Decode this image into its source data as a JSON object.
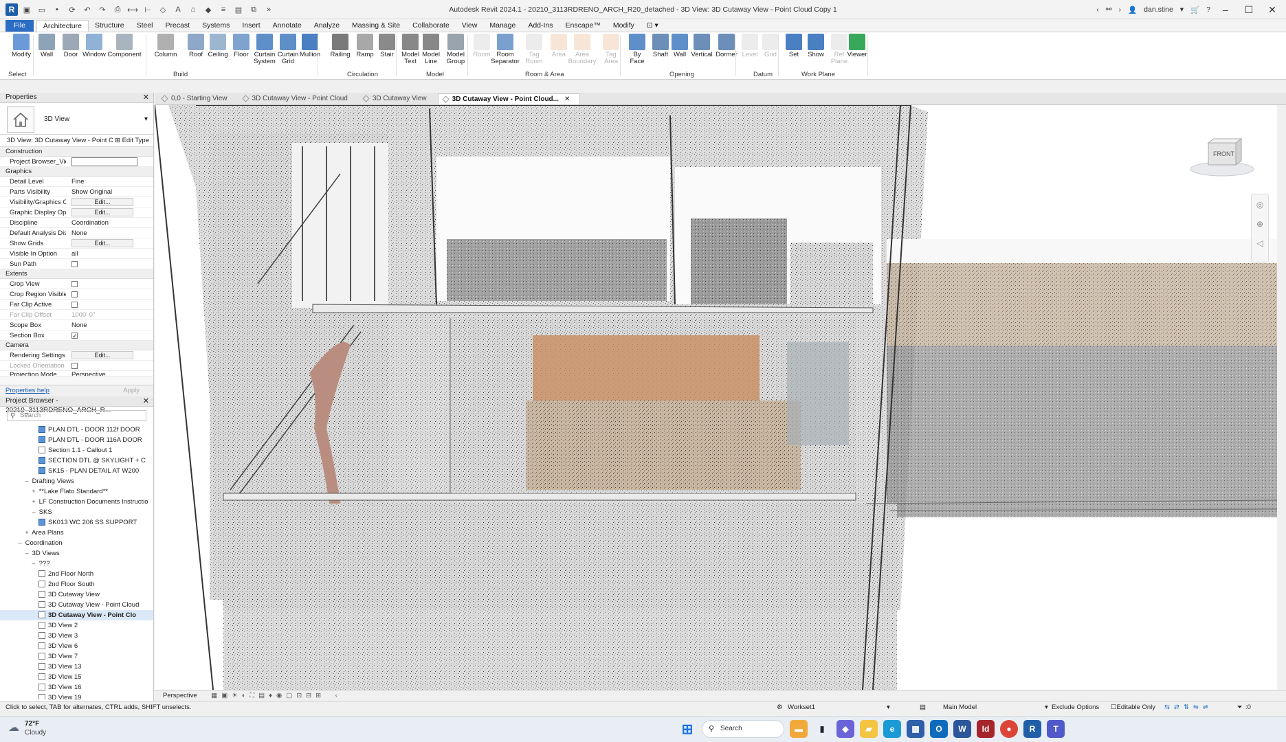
{
  "app": {
    "title": "Autodesk Revit 2024.1 - 20210_3113RDRENO_ARCH_R20_detached - 3D View: 3D Cutaway View - Point Cloud Copy 1",
    "user": "dan.stine"
  },
  "ribbon_tabs": [
    "File",
    "Architecture",
    "Structure",
    "Steel",
    "Precast",
    "Systems",
    "Insert",
    "Annotate",
    "Analyze",
    "Massing & Site",
    "Collaborate",
    "View",
    "Manage",
    "Add-Ins",
    "Enscape™",
    "Modify"
  ],
  "active_ribbon_tab": "Architecture",
  "ribbon": {
    "tools": [
      {
        "label": "Modify",
        "icon": "modify-arrow-icon"
      },
      {
        "label": "Wall",
        "icon": "wall-icon"
      },
      {
        "label": "Door",
        "icon": "door-icon"
      },
      {
        "label": "Window",
        "icon": "window-icon"
      },
      {
        "label": "Component",
        "icon": "component-icon"
      },
      {
        "label": "Column",
        "icon": "column-icon"
      },
      {
        "label": "Roof",
        "icon": "roof-icon"
      },
      {
        "label": "Ceiling",
        "icon": "ceiling-icon"
      },
      {
        "label": "Floor",
        "icon": "floor-icon"
      },
      {
        "label": "Curtain System",
        "icon": "curtain-system-icon"
      },
      {
        "label": "Curtain Grid",
        "icon": "curtain-grid-icon"
      },
      {
        "label": "Mullion",
        "icon": "mullion-icon"
      },
      {
        "label": "Railing",
        "icon": "railing-icon"
      },
      {
        "label": "Ramp",
        "icon": "ramp-icon"
      },
      {
        "label": "Stair",
        "icon": "stair-icon"
      },
      {
        "label": "Model Text",
        "icon": "model-text-icon"
      },
      {
        "label": "Model Line",
        "icon": "model-line-icon"
      },
      {
        "label": "Model Group",
        "icon": "model-group-icon"
      },
      {
        "label": "Room",
        "icon": "room-icon"
      },
      {
        "label": "Room Separator",
        "icon": "room-separator-icon"
      },
      {
        "label": "Tag Room",
        "icon": "tag-room-icon"
      },
      {
        "label": "Area",
        "icon": "area-icon"
      },
      {
        "label": "Area Boundary",
        "icon": "area-boundary-icon"
      },
      {
        "label": "Tag Area",
        "icon": "tag-area-icon"
      },
      {
        "label": "By Face",
        "icon": "by-face-icon"
      },
      {
        "label": "Shaft",
        "icon": "shaft-icon"
      },
      {
        "label": "Wall",
        "icon": "wall-opening-icon"
      },
      {
        "label": "Vertical",
        "icon": "vertical-icon"
      },
      {
        "label": "Dormer",
        "icon": "dormer-icon"
      },
      {
        "label": "Level",
        "icon": "level-icon"
      },
      {
        "label": "Grid",
        "icon": "grid-icon"
      },
      {
        "label": "Set",
        "icon": "set-icon"
      },
      {
        "label": "Show",
        "icon": "show-icon"
      },
      {
        "label": "Ref Plane",
        "icon": "ref-plane-icon"
      },
      {
        "label": "Viewer",
        "icon": "viewer-icon"
      }
    ],
    "groups": [
      "Select",
      "Build",
      "Circulation",
      "Model",
      "Room & Area",
      "Opening",
      "Datum",
      "Work Plane"
    ]
  },
  "properties": {
    "title": "Properties",
    "type_name": "3D View",
    "instance": "3D View: 3D Cutaway View - Point C",
    "edit_type": "Edit Type",
    "categories": {
      "construction": "Construction",
      "graphics": "Graphics",
      "extents": "Extents",
      "camera": "Camera"
    },
    "rows": {
      "project_browser_view": {
        "name": "Project Browser_View...",
        "value": ""
      },
      "detail_level": {
        "name": "Detail Level",
        "value": "Fine"
      },
      "parts_visibility": {
        "name": "Parts Visibility",
        "value": "Show Original"
      },
      "vis_graphics": {
        "name": "Visibility/Graphics O...",
        "value": "Edit..."
      },
      "graphic_display": {
        "name": "Graphic Display Opti...",
        "value": "Edit..."
      },
      "discipline": {
        "name": "Discipline",
        "value": "Coordination"
      },
      "default_analysis": {
        "name": "Default Analysis Dis...",
        "value": "None"
      },
      "show_grids": {
        "name": "Show Grids",
        "value": "Edit..."
      },
      "visible_in_option": {
        "name": "Visible In Option",
        "value": "all"
      },
      "sun_path": {
        "name": "Sun Path",
        "value": ""
      },
      "crop_view": {
        "name": "Crop View",
        "value": ""
      },
      "crop_region_visible": {
        "name": "Crop Region Visible",
        "value": ""
      },
      "far_clip_active": {
        "name": "Far Clip Active",
        "value": ""
      },
      "far_clip_offset": {
        "name": "Far Clip Offset",
        "value": "1000'  0\""
      },
      "scope_box": {
        "name": "Scope Box",
        "value": "None"
      },
      "section_box": {
        "name": "Section Box",
        "value": ""
      },
      "rendering_settings": {
        "name": "Rendering Settings",
        "value": "Edit..."
      },
      "locked_orientation": {
        "name": "Locked Orientation",
        "value": ""
      },
      "projection_mode": {
        "name": "Projection Mode",
        "value": "Perspective"
      }
    },
    "help": "Properties help",
    "apply": "Apply"
  },
  "browser": {
    "title": "Project Browser - 20210_3113RDRENO_ARCH_R...",
    "search_placeholder": "Search",
    "rows": [
      {
        "label": "PLAN DTL - DOOR 112f DOOR",
        "indent": 56,
        "kind": "blue"
      },
      {
        "label": "PLAN DTL - DOOR 116A DOOR",
        "indent": 56,
        "kind": "blue"
      },
      {
        "label": "Section 1.1 - Callout 1",
        "indent": 56,
        "kind": "view"
      },
      {
        "label": "SECTION DTL @ SKYLIGHT + C",
        "indent": 56,
        "kind": "blue"
      },
      {
        "label": "SK15 - PLAN DETAIL AT W200",
        "indent": 56,
        "kind": "blue"
      },
      {
        "label": "Drafting Views",
        "indent": 34,
        "kind": "minus"
      },
      {
        "label": "**Lake Flato Standard**",
        "indent": 44,
        "kind": "plus"
      },
      {
        "label": "LF Construction Documents Instructio",
        "indent": 44,
        "kind": "plus"
      },
      {
        "label": "SKS",
        "indent": 44,
        "kind": "minus"
      },
      {
        "label": "SK013 WC 206 SS SUPPORT",
        "indent": 56,
        "kind": "blue"
      },
      {
        "label": "Area Plans",
        "indent": 34,
        "kind": "plus"
      },
      {
        "label": "Coordination",
        "indent": 24,
        "kind": "minus"
      },
      {
        "label": "3D Views",
        "indent": 34,
        "kind": "minus"
      },
      {
        "label": "???",
        "indent": 44,
        "kind": "minus"
      },
      {
        "label": "2nd Floor North",
        "indent": 56,
        "kind": "view"
      },
      {
        "label": "2nd Floor South",
        "indent": 56,
        "kind": "view"
      },
      {
        "label": "3D Cutaway View",
        "indent": 56,
        "kind": "view"
      },
      {
        "label": "3D Cutaway View - Point Cloud",
        "indent": 56,
        "kind": "view"
      },
      {
        "label": "3D Cutaway View - Point Clo",
        "indent": 56,
        "kind": "view",
        "selected": true
      },
      {
        "label": "3D View 2",
        "indent": 56,
        "kind": "view"
      },
      {
        "label": "3D View 3",
        "indent": 56,
        "kind": "view"
      },
      {
        "label": "3D View 6",
        "indent": 56,
        "kind": "view"
      },
      {
        "label": "3D View 7",
        "indent": 56,
        "kind": "view"
      },
      {
        "label": "3D View 13",
        "indent": 56,
        "kind": "view"
      },
      {
        "label": "3D View 15",
        "indent": 56,
        "kind": "view"
      },
      {
        "label": "3D View 16",
        "indent": 56,
        "kind": "view"
      },
      {
        "label": "3D View 19",
        "indent": 56,
        "kind": "view"
      }
    ]
  },
  "doc_tabs": [
    {
      "label": "0,0 - Starting View"
    },
    {
      "label": "3D Cutaway View - Point Cloud"
    },
    {
      "label": "3D Cutaway View"
    },
    {
      "label": "3D Cutaway View - Point Cloud...",
      "active": true
    }
  ],
  "viewcube": {
    "face": "FRONT"
  },
  "view_control": {
    "mode": "Perspective"
  },
  "status": {
    "hint": "Click to select, TAB for alternates, CTRL adds, SHIFT unselects.",
    "workset": "Workset1",
    "model": "Main Model",
    "exclude_options": "Exclude Options",
    "editable_only": "Editable Only",
    "filter_count": ":0"
  },
  "taskbar": {
    "temperature": "72°F",
    "condition": "Cloudy",
    "search": "Search"
  }
}
